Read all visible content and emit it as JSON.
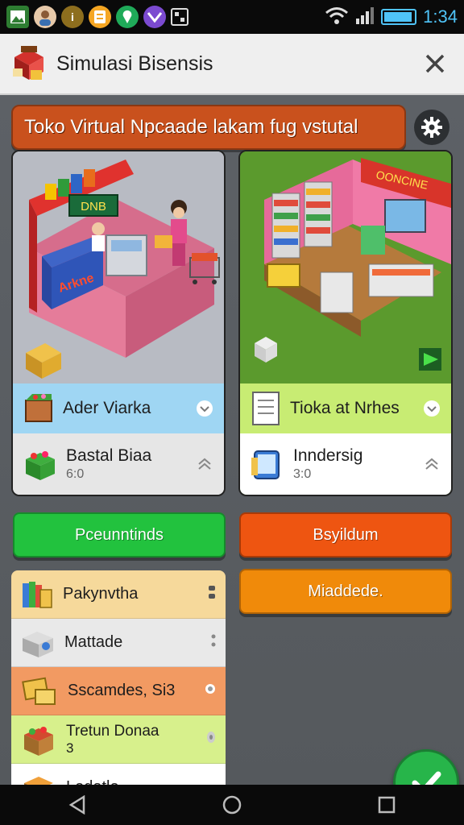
{
  "status_bar": {
    "time": "1:34",
    "icons": [
      "image-icon",
      "avatar-icon",
      "info-icon",
      "notes-icon",
      "location-icon",
      "app-icon",
      "qr-icon"
    ]
  },
  "app_bar": {
    "title": "Simulasi Bisensis"
  },
  "banner": {
    "text": "Toko Virtual Npcaade lakam fug vstutal"
  },
  "left_card": {
    "sign_top": "DNB",
    "sign_counter": "Arkne",
    "row1": {
      "label": "Ader Viarka"
    },
    "row2": {
      "label": "Bastal Biaa",
      "sub": "6:0"
    }
  },
  "right_card": {
    "sign_top": "OONCINE",
    "row1": {
      "label": "Tioka at Nrhes"
    },
    "row2": {
      "label": "Inndersig",
      "sub": "3:0"
    }
  },
  "buttons": {
    "green": "Pceunntinds",
    "orange_red": "Bsyildum",
    "orange": "Miaddede."
  },
  "list": [
    {
      "label": "Pakynvtha",
      "color": "#f6d99b"
    },
    {
      "label": "Mattade",
      "color": "#e9e9e9"
    },
    {
      "label": "Sscamdes, Si3",
      "color": "#f29a62"
    },
    {
      "label": "Tretun Donaa",
      "sub": "3",
      "color": "#d7f08c"
    },
    {
      "label": "Ledatle",
      "color": "#ffffff"
    }
  ],
  "colors": {
    "banner": "#c9511d",
    "green_button": "#22c23e",
    "orange_red_button": "#ee5511",
    "orange_button": "#f08a0a",
    "fab": "#27b54a"
  }
}
